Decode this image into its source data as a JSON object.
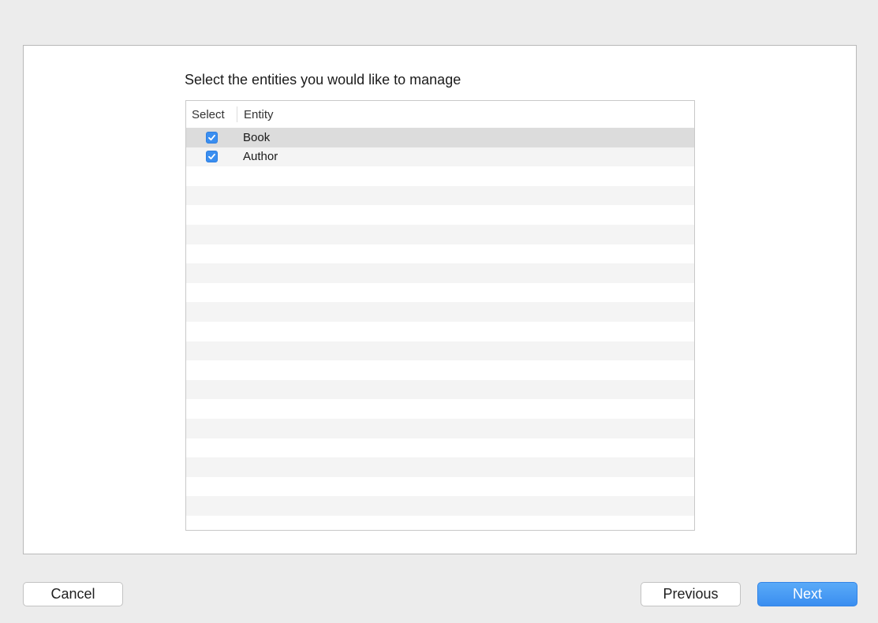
{
  "wizard": {
    "prompt": "Select the entities you would like to manage"
  },
  "table": {
    "columns": {
      "select": "Select",
      "entity": "Entity"
    },
    "rows": [
      {
        "entity": "Book",
        "checked": true,
        "selected": true
      },
      {
        "entity": "Author",
        "checked": true,
        "selected": false
      }
    ],
    "empty_rows": 19
  },
  "buttons": {
    "cancel": "Cancel",
    "previous": "Previous",
    "next": "Next"
  },
  "colors": {
    "accent": "#3a8ef0",
    "selected_row": "#dcdcdc",
    "alt_row": "#f4f4f4"
  },
  "icons": {
    "checkbox": "checkmark-icon"
  }
}
